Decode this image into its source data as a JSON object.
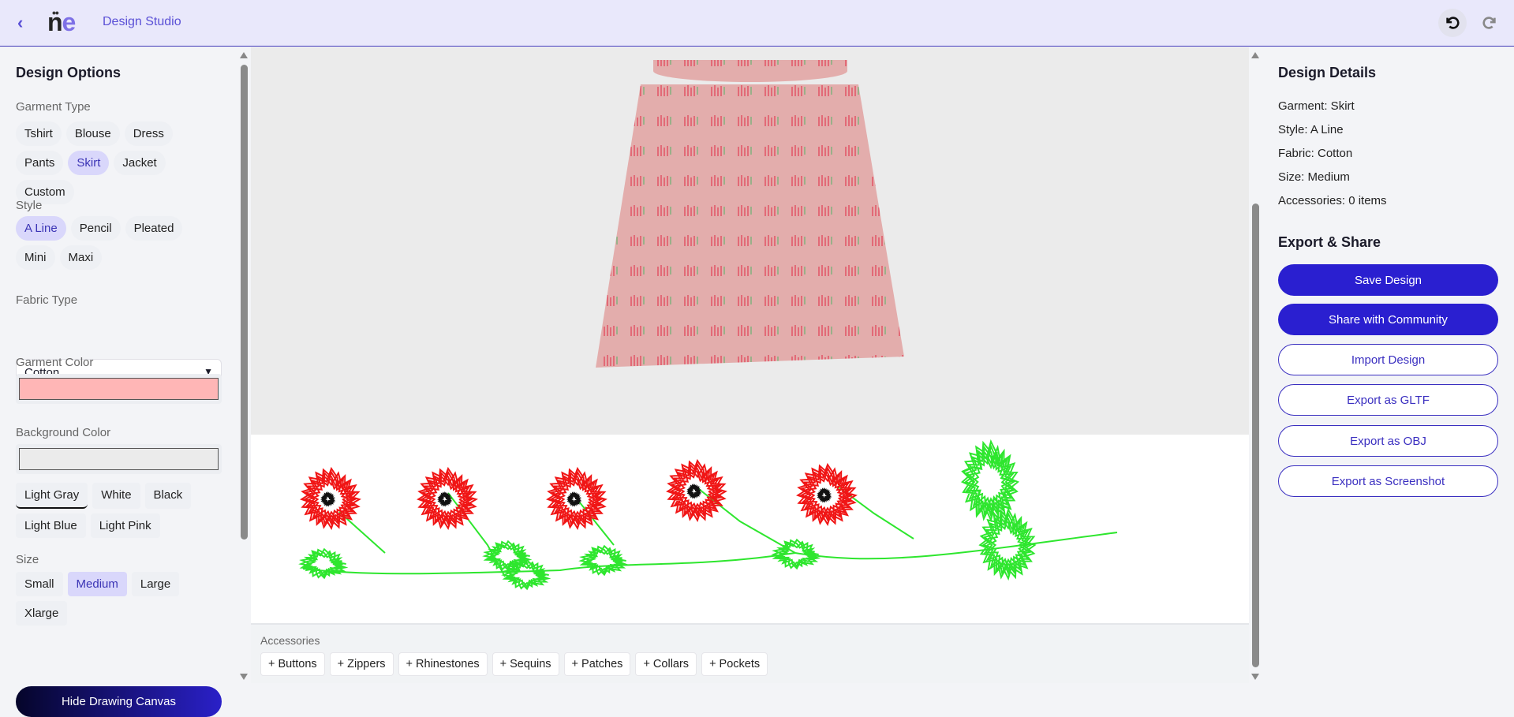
{
  "header": {
    "title": "Design Studio",
    "logo": "ne"
  },
  "left": {
    "heading": "Design Options",
    "garment_label": "Garment Type",
    "garments": [
      "Tshirt",
      "Blouse",
      "Dress",
      "Pants",
      "Skirt",
      "Jacket",
      "Custom"
    ],
    "style_label": "Style",
    "styles": [
      "A Line",
      "Pencil",
      "Pleated",
      "Mini",
      "Maxi"
    ],
    "fabric_label": "Fabric Type",
    "fabric_value": "Cotton",
    "garment_color_label": "Garment Color",
    "garment_color": "#ffb6b6",
    "bg_color_label": "Background Color",
    "bg_color": "#ebebeb",
    "bg_presets": [
      "Light Gray",
      "White",
      "Black",
      "Light Blue",
      "Light Pink"
    ],
    "size_label": "Size",
    "sizes": [
      "Small",
      "Medium",
      "Large",
      "Xlarge"
    ],
    "hide_canvas": "Hide Drawing Canvas"
  },
  "accessories": {
    "label": "Accessories",
    "items": [
      "+ Buttons",
      "+ Zippers",
      "+ Rhinestones",
      "+ Sequins",
      "+ Patches",
      "+ Collars",
      "+ Pockets"
    ]
  },
  "right": {
    "details_heading": "Design Details",
    "details": [
      "Garment: Skirt",
      "Style: A Line",
      "Fabric: Cotton",
      "Size: Medium",
      "Accessories: 0 items"
    ],
    "export_heading": "Export & Share",
    "buttons": [
      "Save Design",
      "Share with Community",
      "Import Design",
      "Export as GLTF",
      "Export as OBJ",
      "Export as Screenshot"
    ]
  },
  "colors": {
    "accent": "#2a1fd0",
    "header_bg": "#e9e8fb"
  }
}
